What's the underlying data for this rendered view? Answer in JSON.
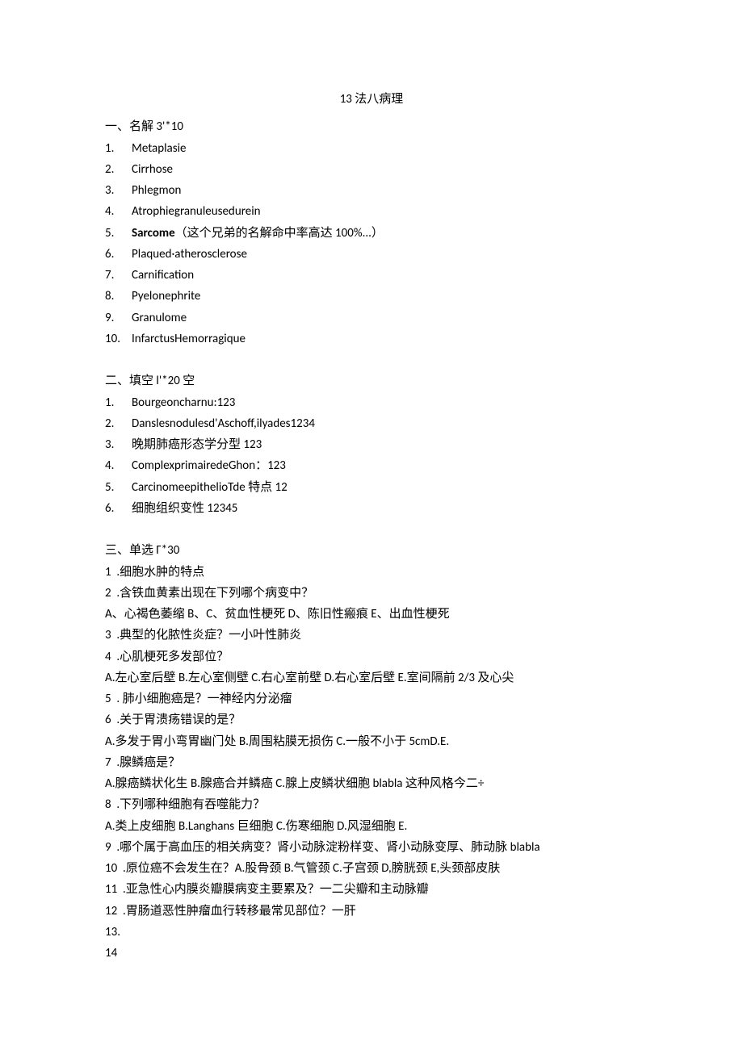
{
  "title": "13 法八病理",
  "section1": {
    "header": "一、名解 3'*10",
    "items": [
      "Metaplasie",
      "Cirrhose",
      "Phlegmon",
      "Atrophiegranuleusedurein",
      "",
      "Plaqued·atherosclerose",
      "Carnification",
      "Pyelonephrite",
      "Granulome",
      "  InfarctusHemorragique"
    ],
    "item5_bold": "Sarcome",
    "item5_rest": "（这个兄弟的名解命中率高达 100%...）"
  },
  "section2": {
    "header": "二、填空 l'*20 空",
    "items": [
      "Bourgeoncharnu:123",
      "Danslesnodulesd'Aschoff,ilyades1234",
      "晚期肺癌形态学分型 123",
      "ComplexprimairedeGhon：123",
      "CarcinomeepithelioTde 特点 12",
      "细胞组织变性 12345"
    ]
  },
  "section3": {
    "header": "三、单选 Γ*30",
    "lines": [
      "1  .细胞水肿的特点",
      "2  .含铁血黄素出现在下列哪个病变中？",
      "A、心褐色萎缩 B、C、贫血性梗死 D、陈旧性瘢痕 E、出血性梗死",
      "3  .典型的化脓性炎症？一小叶性肺炎",
      "4  .心肌梗死多发部位？",
      "A.左心室后壁 B.左心室侧壁 C.右心室前壁 D.右心室后壁 E.室间隔前 2/3 及心尖",
      "5  . 肺小细胞癌是？一神经内分泌瘤",
      "6  .关于胃溃疡错误的是？",
      "A.多发于胃小弯胃幽门处 B.周围粘膜无损伤 C.一般不小于 5cmD.E.",
      "7  .腺鳞癌是？",
      "A.腺癌鳞状化生 B.腺癌合并鳞癌 C.腺上皮鳞状细胞 blabla 这种风格今二÷",
      "8  .下列哪种细胞有吞噬能力？",
      "A.类上皮细胞 B.Langhans 巨细胞 C.伤寒细胞 D.风湿细胞 E.",
      "9  .哪个属于高血压的相关病变？肾小动脉淀粉样变、肾小动脉变厚、肺动脉 blabla",
      "10  .原位癌不会发生在？A.股骨颈 B.气管颈 C.子宫颈 D,膀胱颈 E,头颈部皮肤",
      "11  .亚急性心内膜炎瓣膜病变主要累及？一二尖瓣和主动脉瓣",
      "12  .胃肠道恶性肿瘤血行转移最常见部位？一肝",
      "13.",
      "14"
    ]
  }
}
